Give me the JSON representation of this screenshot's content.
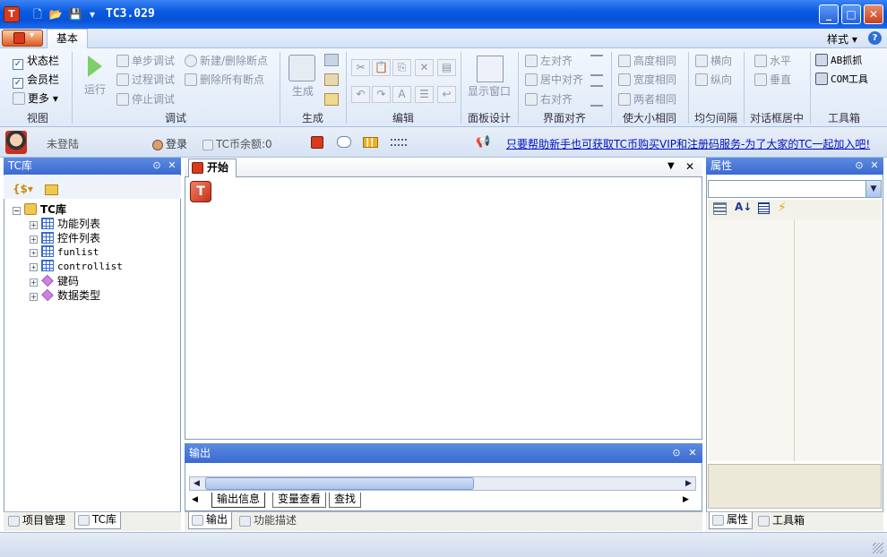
{
  "window": {
    "title": "TC3.029",
    "app_icon_letter": "T"
  },
  "qat": {
    "new": "🗋",
    "open": "📂",
    "save": "💾",
    "more": "▾"
  },
  "ribbon_tabs": {
    "basic": "基本",
    "style_menu": "样式 ▾",
    "help": "?"
  },
  "ribbon": {
    "view": {
      "label": "视图",
      "status_bar": "状态栏",
      "member_bar": "会员栏",
      "more": "更多 ▾"
    },
    "debug": {
      "label": "调试",
      "run": "运行",
      "step": "单步调试",
      "process": "过程调试",
      "stop": "停止调试",
      "toggle_bp": "新建/删除断点",
      "delete_all_bp": "删除所有断点"
    },
    "generate": {
      "label": "生成",
      "generate": "生成"
    },
    "edit": {
      "label": "编辑"
    },
    "panel_design": {
      "label": "面板设计",
      "show_window": "显示窗口"
    },
    "align": {
      "label": "界面对齐",
      "left": "左对齐",
      "center": "居中对齐",
      "right": "右对齐"
    },
    "size": {
      "label": "使大小相同",
      "height": "高度相同",
      "width": "宽度相同",
      "both": "两者相同"
    },
    "spacing": {
      "label": "均匀间隔",
      "horizontal": "横向",
      "vertical": "纵向"
    },
    "dialog_center": {
      "label": "对话框居中",
      "horizontal": "水平",
      "vertical": "垂直"
    },
    "toolbox": {
      "label": "工具箱",
      "ab_grab": "AB抓抓",
      "com_tool": "COM工具"
    }
  },
  "userbar": {
    "not_logged_in": "未登陆",
    "login": "登录",
    "balance": "TC币余额:0",
    "link": "只要帮助新手也可获取TC币购买VIP和注册码服务-为了大家的TC一起加入吧!"
  },
  "left_panel": {
    "title": "TC库",
    "tree": {
      "root": "TC库",
      "children": [
        "功能列表",
        "控件列表",
        "funlist",
        "controllist",
        "键码",
        "数据类型"
      ]
    },
    "bottom_tabs": [
      "项目管理",
      "TC库"
    ]
  },
  "doc": {
    "tab": "开始"
  },
  "output": {
    "title": "输出",
    "tabs": [
      "输出信息",
      "变量查看",
      "查找"
    ],
    "bottom_tabs": [
      "输出",
      "功能描述"
    ]
  },
  "right_panel": {
    "title": "属性",
    "bottom_tabs": [
      "属性",
      "工具箱"
    ]
  },
  "icons": {
    "pin": "pin-icon",
    "close": "close-icon"
  }
}
